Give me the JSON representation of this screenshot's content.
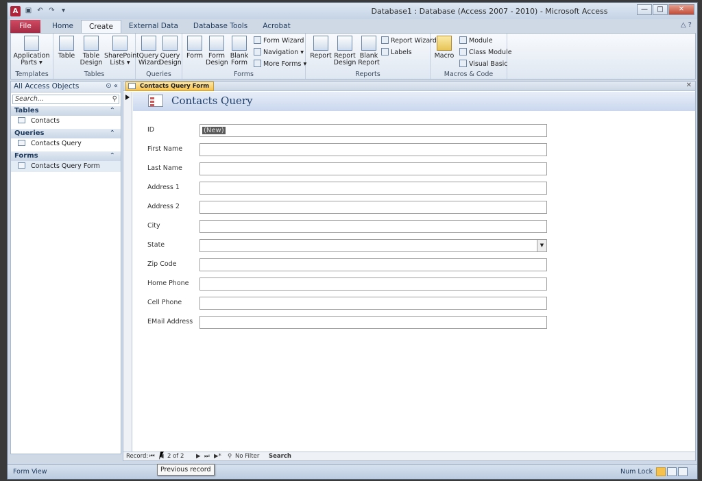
{
  "window": {
    "title": "Database1 : Database (Access 2007 - 2010) - Microsoft Access"
  },
  "window_buttons": {
    "minimize": "—",
    "maximize": "□",
    "close": "✕"
  },
  "tabs": [
    {
      "label": "File"
    },
    {
      "label": "Home"
    },
    {
      "label": "Create"
    },
    {
      "label": "External Data"
    },
    {
      "label": "Database Tools"
    },
    {
      "label": "Acrobat"
    }
  ],
  "ribbon": {
    "templates": {
      "label": "Templates",
      "application_parts": "Application Parts ▾"
    },
    "tables": {
      "label": "Tables",
      "table": "Table",
      "table_design": "Table Design",
      "sharepoint_lists": "SharePoint Lists ▾"
    },
    "queries": {
      "label": "Queries",
      "query_wizard": "Query Wizard",
      "query_design": "Query Design"
    },
    "forms": {
      "label": "Forms",
      "form": "Form",
      "form_design": "Form Design",
      "blank_form": "Blank Form",
      "form_wizard": "Form Wizard",
      "navigation": "Navigation ▾",
      "more_forms": "More Forms ▾"
    },
    "reports": {
      "label": "Reports",
      "report": "Report",
      "report_design": "Report Design",
      "blank_report": "Blank Report",
      "report_wizard": "Report Wizard",
      "labels": "Labels"
    },
    "macros": {
      "label": "Macros & Code",
      "macro": "Macro",
      "module": "Module",
      "class_module": "Class Module",
      "visual_basic": "Visual Basic"
    }
  },
  "navpane": {
    "title": "All Access Objects",
    "search_placeholder": "Search...",
    "groups": [
      {
        "label": "Tables",
        "items": [
          "Contacts"
        ]
      },
      {
        "label": "Queries",
        "items": [
          "Contacts Query"
        ]
      },
      {
        "label": "Forms",
        "items": [
          "Contacts Query Form"
        ]
      }
    ]
  },
  "document": {
    "tab_label": "Contacts Query Form",
    "form_title": "Contacts Query",
    "fields": [
      {
        "label": "ID",
        "value": "(New)"
      },
      {
        "label": "First Name",
        "value": ""
      },
      {
        "label": "Last Name",
        "value": ""
      },
      {
        "label": "Address 1",
        "value": ""
      },
      {
        "label": "Address 2",
        "value": ""
      },
      {
        "label": "City",
        "value": ""
      },
      {
        "label": "State",
        "value": ""
      },
      {
        "label": "Zip Code",
        "value": ""
      },
      {
        "label": "Home Phone",
        "value": ""
      },
      {
        "label": "Cell Phone",
        "value": ""
      },
      {
        "label": "EMail Address",
        "value": ""
      }
    ]
  },
  "record_nav": {
    "label": "Record:",
    "first": "⏮",
    "prev": "◀",
    "position": "2 of 2",
    "next": "▶",
    "last": "⏭",
    "new": "▶*",
    "filter": "No Filter",
    "search": "Search"
  },
  "status": {
    "view": "Form View",
    "num_lock": "Num Lock"
  },
  "tooltip": {
    "text": "Previous record"
  }
}
